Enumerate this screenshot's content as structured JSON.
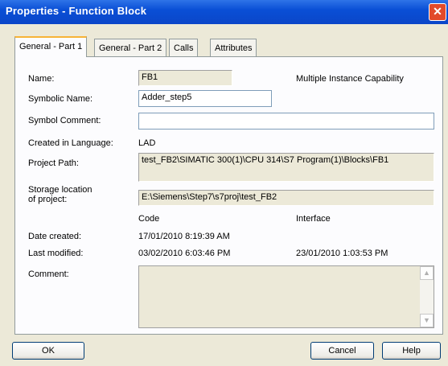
{
  "window": {
    "title": "Properties - Function Block",
    "close_glyph": "✕"
  },
  "tabs": [
    {
      "label": "General - Part 1"
    },
    {
      "label": "General - Part 2"
    },
    {
      "label": "Calls"
    },
    {
      "label": "Attributes"
    }
  ],
  "form": {
    "name_label": "Name:",
    "name_value": "FB1",
    "multiple_instance_label": "Multiple Instance Capability",
    "symbolic_name_label": "Symbolic Name:",
    "symbolic_name_value": "Adder_step5",
    "symbol_comment_label": "Symbol Comment:",
    "symbol_comment_value": "",
    "created_in_language_label": "Created in Language:",
    "created_in_language_value": "LAD",
    "project_path_label": "Project Path:",
    "project_path_value": "test_FB2\\SIMATIC 300(1)\\CPU 314\\S7 Program(1)\\Blocks\\FB1",
    "storage_location_label_1": "Storage location",
    "storage_location_label_2": "of project:",
    "storage_location_value": "E:\\Siemens\\Step7\\s7proj\\test_FB2",
    "code_header": "Code",
    "interface_header": "Interface",
    "date_created_label": "Date created:",
    "date_created_code": "17/01/2010  8:19:39 AM",
    "last_modified_label": "Last modified:",
    "last_modified_code": "03/02/2010  6:03:46 PM",
    "last_modified_interface": "23/01/2010  1:03:53 PM",
    "comment_label": "Comment:",
    "comment_value": ""
  },
  "buttons": {
    "ok": "OK",
    "cancel": "Cancel",
    "help": "Help"
  },
  "icons": {
    "scroll_up": "scroll-up-icon",
    "scroll_down": "scroll-down-icon"
  },
  "colors": {
    "titlebar": "#0a4fd6",
    "dialog_bg": "#ece9d8",
    "tab_accent": "#f7b337"
  }
}
